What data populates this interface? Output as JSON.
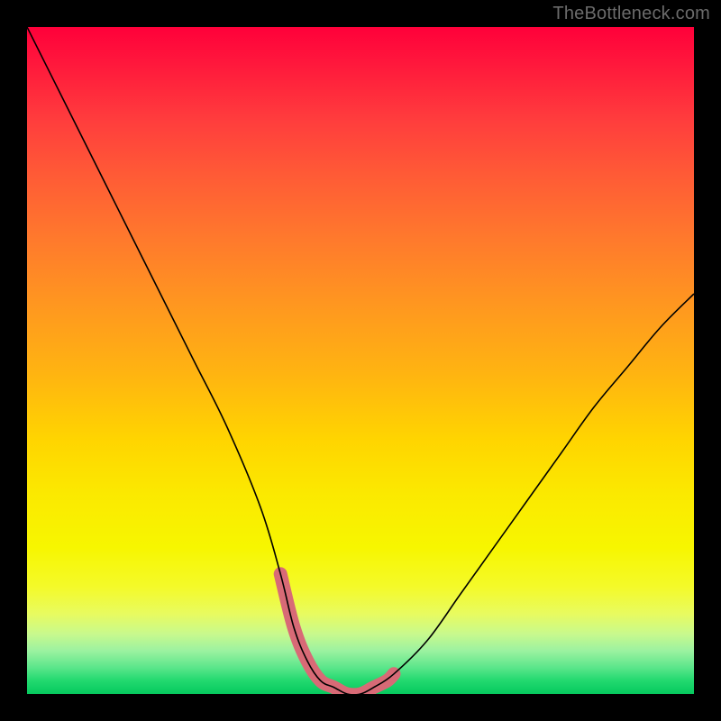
{
  "watermark": "TheBottleneck.com",
  "chart_data": {
    "type": "line",
    "title": "",
    "xlabel": "",
    "ylabel": "",
    "xlim": [
      0,
      100
    ],
    "ylim": [
      0,
      100
    ],
    "grid": false,
    "series": [
      {
        "name": "bottleneck-curve",
        "x": [
          0,
          5,
          10,
          15,
          20,
          25,
          30,
          35,
          38,
          40,
          42,
          44,
          46,
          48,
          50,
          52,
          55,
          60,
          65,
          70,
          75,
          80,
          85,
          90,
          95,
          100
        ],
        "values": [
          100,
          90,
          80,
          70,
          60,
          50,
          40,
          28,
          18,
          10,
          5,
          2,
          1,
          0,
          0,
          1,
          3,
          8,
          15,
          22,
          29,
          36,
          43,
          49,
          55,
          60
        ]
      }
    ],
    "highlight_segment": {
      "name": "sweet-spot",
      "x": [
        38,
        40,
        42,
        44,
        46,
        48,
        50,
        52,
        54,
        55
      ],
      "values": [
        18,
        10,
        5,
        2,
        1,
        0,
        0,
        1,
        2,
        3
      ]
    },
    "background_gradient": {
      "top": "#ff003a",
      "mid": "#ffd500",
      "bottom": "#06c95e"
    }
  }
}
